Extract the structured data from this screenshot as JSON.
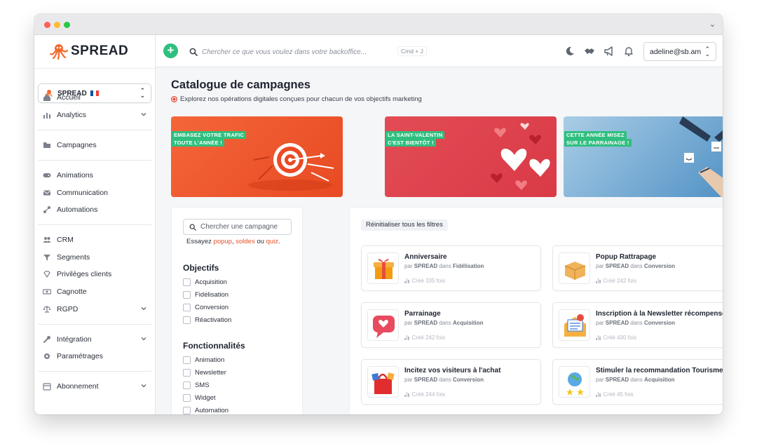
{
  "app": {
    "brand": "SPREAD"
  },
  "account": {
    "name": "SPREAD"
  },
  "sidebar": {
    "items": [
      {
        "label": "Accueil",
        "icon": "home-icon"
      },
      {
        "label": "Analytics",
        "icon": "analytics-icon"
      },
      {
        "label": "Campagnes",
        "icon": "folder-icon"
      },
      {
        "label": "Animations",
        "icon": "gamepad-icon"
      },
      {
        "label": "Communication",
        "icon": "mail-icon"
      },
      {
        "label": "Automations",
        "icon": "automation-icon"
      },
      {
        "label": "CRM",
        "icon": "users-icon"
      },
      {
        "label": "Segments",
        "icon": "filter-icon"
      },
      {
        "label": "Privilèges clients",
        "icon": "gem-icon"
      },
      {
        "label": "Cagnotte",
        "icon": "money-icon"
      },
      {
        "label": "RGPD",
        "icon": "scale-icon"
      },
      {
        "label": "Intégration",
        "icon": "wrench-icon"
      },
      {
        "label": "Paramétrages",
        "icon": "gear-icon"
      },
      {
        "label": "Abonnement",
        "icon": "calendar-icon"
      }
    ]
  },
  "topbar": {
    "search_placeholder": "Chercher ce que vous voulez dans votre backoffice...",
    "shortcut": "Cmd + J",
    "user": "adeline@sb.am"
  },
  "page": {
    "title": "Catalogue de campagnes",
    "subtitle": "Explorez nos opérations digitales conçues pour chacun de vos objectifs marketing"
  },
  "banners": [
    {
      "line1": "EMBASEZ VOTRE TRAFIC",
      "line2": "TOUTE L'ANNÉE !"
    },
    {
      "line1": "LA SAINT-VALENTIN",
      "line2": "C'EST BIENTÔT !"
    },
    {
      "line1": "CETTE ANNÉE MISEZ",
      "line2": "SUR LE PARRAINAGE !"
    }
  ],
  "filters": {
    "search_placeholder": "Chercher une campagne",
    "suggest_prefix": "Essayez",
    "suggest_links": [
      "popup",
      "soldes",
      "quiz"
    ],
    "suggest_or": "ou",
    "objectifs_title": "Objectifs",
    "objectifs": [
      "Acquisition",
      "Fidélisation",
      "Conversion",
      "Réactivation"
    ],
    "fonctionnalites_title": "Fonctionnalités",
    "fonctionnalites": [
      "Animation",
      "Newsletter",
      "SMS",
      "Widget",
      "Automation"
    ]
  },
  "results": {
    "reset_label": "Réinitialiser tous les filtres",
    "by": "par",
    "in": "dans",
    "cards": [
      {
        "title": "Anniversaire",
        "author": "SPREAD",
        "category": "Fidélisation",
        "count": "Créé 335 fois"
      },
      {
        "title": "Popup Rattrapage",
        "author": "SPREAD",
        "category": "Conversion",
        "count": "Créé 242 fois"
      },
      {
        "title": "Parrainage",
        "author": "SPREAD",
        "category": "Acquisition",
        "count": "Créé 242 fois"
      },
      {
        "title": "Inscription à la Newsletter récompensée",
        "author": "SPREAD",
        "category": "Conversion",
        "count": "Créé 430 fois"
      },
      {
        "title": "Incitez vos visiteurs à l'achat",
        "author": "SPREAD",
        "category": "Conversion",
        "count": "Créé 244 fois"
      },
      {
        "title": "Stimuler la recommandation Tourisme",
        "author": "SPREAD",
        "category": "Acquisition",
        "count": "Créé 45 fois"
      }
    ]
  },
  "colors": {
    "accent": "#2fbf7f",
    "brand": "#f26a2e",
    "link": "#e5502b"
  }
}
